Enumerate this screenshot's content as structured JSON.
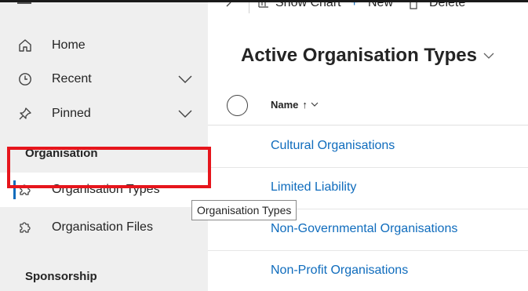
{
  "toolbar": {
    "show_chart_label": "Show Chart",
    "new_label": "New",
    "delete_label": "Delete"
  },
  "sidebar": {
    "items": [
      {
        "label": "Home",
        "icon": "home-icon"
      },
      {
        "label": "Recent",
        "icon": "clock-icon"
      },
      {
        "label": "Pinned",
        "icon": "pin-icon"
      }
    ],
    "sections": [
      {
        "title": "Organisation",
        "items": [
          {
            "label": "Organisation Types",
            "icon": "puzzle-icon",
            "selected": true
          },
          {
            "label": "Organisation Files",
            "icon": "puzzle-icon"
          }
        ]
      },
      {
        "title": "Sponsorship"
      }
    ]
  },
  "main": {
    "view_title": "Active Organisation Types",
    "column_name": "Name",
    "sort_indicator": "↑",
    "rows": [
      "Cultural Organisations",
      "Limited Liability",
      "Non-Governmental Organisations",
      "Non-Profit Organisations"
    ]
  },
  "tooltip": {
    "text": "Organisation Types"
  },
  "colors": {
    "accent": "#0f6cbd",
    "highlight": "#e6151c",
    "sidebar_bg": "#efefef"
  }
}
